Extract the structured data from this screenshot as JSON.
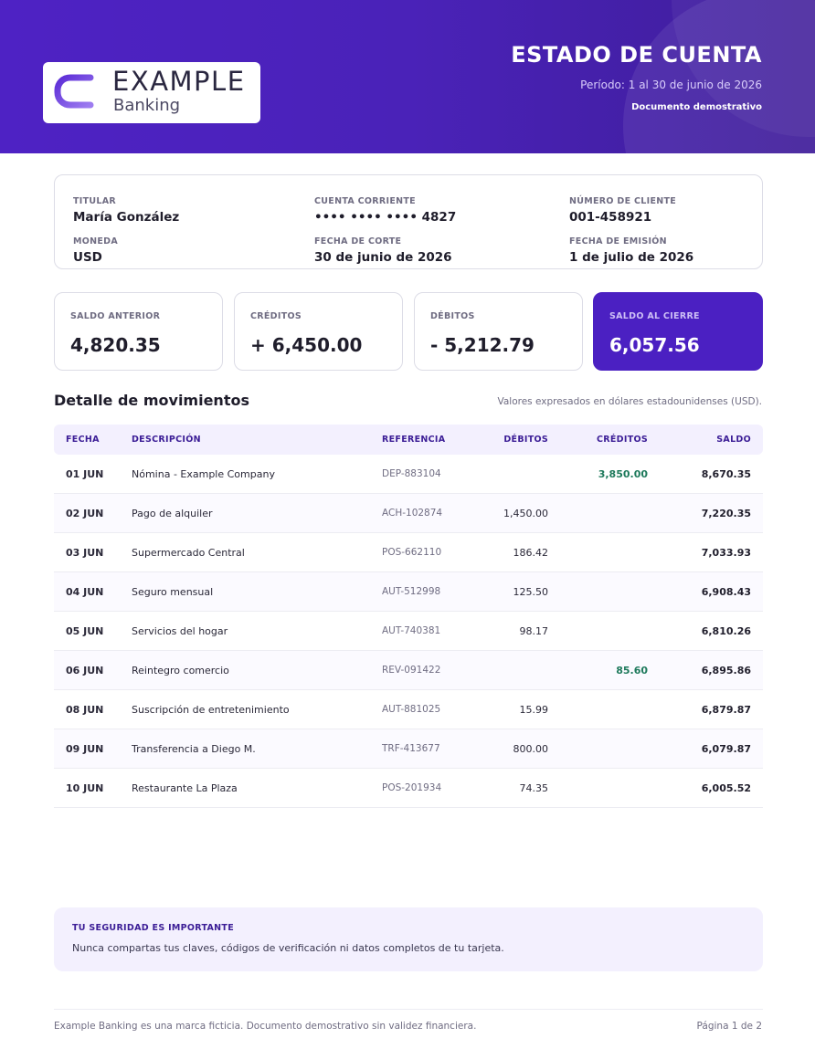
{
  "brand": {
    "name": "EXAMPLE",
    "sub": "Banking",
    "primary_color": "#4b20c2",
    "logo_icon": "example-e-logo"
  },
  "header": {
    "title": "ESTADO DE CUENTA",
    "period": "Período: 1 al 30 de junio de 2026",
    "demo": "Documento demostrativo"
  },
  "account": {
    "titular_label": "TITULAR",
    "titular": "María González",
    "cuenta_label": "CUENTA CORRIENTE",
    "cuenta": "•••• •••• •••• 4827",
    "cliente_label": "NÚMERO DE CLIENTE",
    "cliente": "001-458921",
    "moneda_label": "MONEDA",
    "moneda": "USD",
    "corte_label": "FECHA DE CORTE",
    "corte": "30 de junio de 2026",
    "emision_label": "FECHA DE EMISIÓN",
    "emision": "1 de julio de 2026"
  },
  "summary": [
    {
      "label": "SALDO ANTERIOR",
      "value": "4,820.35"
    },
    {
      "label": "CRÉDITOS",
      "value": "+ 6,450.00"
    },
    {
      "label": "DÉBITOS",
      "value": "- 5,212.79"
    },
    {
      "label": "SALDO AL CIERRE",
      "value": "6,057.56"
    }
  ],
  "movements": {
    "title": "Detalle de movimientos",
    "note": "Valores expresados en dólares estadounidenses (USD).",
    "columns": {
      "fecha": "FECHA",
      "descripcion": "DESCRIPCIÓN",
      "referencia": "REFERENCIA",
      "debitos": "DÉBITOS",
      "creditos": "CRÉDITOS",
      "saldo": "SALDO"
    },
    "rows": [
      {
        "fecha": "01 JUN",
        "descripcion": "Nómina - Example Company",
        "referencia": "DEP-883104",
        "debito": "",
        "credito": "3,850.00",
        "saldo": "8,670.35"
      },
      {
        "fecha": "02 JUN",
        "descripcion": "Pago de alquiler",
        "referencia": "ACH-102874",
        "debito": "1,450.00",
        "credito": "",
        "saldo": "7,220.35"
      },
      {
        "fecha": "03 JUN",
        "descripcion": "Supermercado Central",
        "referencia": "POS-662110",
        "debito": "186.42",
        "credito": "",
        "saldo": "7,033.93"
      },
      {
        "fecha": "04 JUN",
        "descripcion": "Seguro mensual",
        "referencia": "AUT-512998",
        "debito": "125.50",
        "credito": "",
        "saldo": "6,908.43"
      },
      {
        "fecha": "05 JUN",
        "descripcion": "Servicios del hogar",
        "referencia": "AUT-740381",
        "debito": "98.17",
        "credito": "",
        "saldo": "6,810.26"
      },
      {
        "fecha": "06 JUN",
        "descripcion": "Reintegro comercio",
        "referencia": "REV-091422",
        "debito": "",
        "credito": "85.60",
        "saldo": "6,895.86"
      },
      {
        "fecha": "08 JUN",
        "descripcion": "Suscripción de entretenimiento",
        "referencia": "AUT-881025",
        "debito": "15.99",
        "credito": "",
        "saldo": "6,879.87"
      },
      {
        "fecha": "09 JUN",
        "descripcion": "Transferencia a Diego M.",
        "referencia": "TRF-413677",
        "debito": "800.00",
        "credito": "",
        "saldo": "6,079.87"
      },
      {
        "fecha": "10 JUN",
        "descripcion": "Restaurante La Plaza",
        "referencia": "POS-201934",
        "debito": "74.35",
        "credito": "",
        "saldo": "6,005.52"
      }
    ]
  },
  "security": {
    "title": "TU SEGURIDAD ES IMPORTANTE",
    "text": "Nunca compartas tus claves, códigos de verificación ni datos completos de tu tarjeta."
  },
  "footer": {
    "left": "Example Banking es una marca ficticia. Documento demostrativo sin validez financiera.",
    "right": "Página 1 de 2"
  }
}
